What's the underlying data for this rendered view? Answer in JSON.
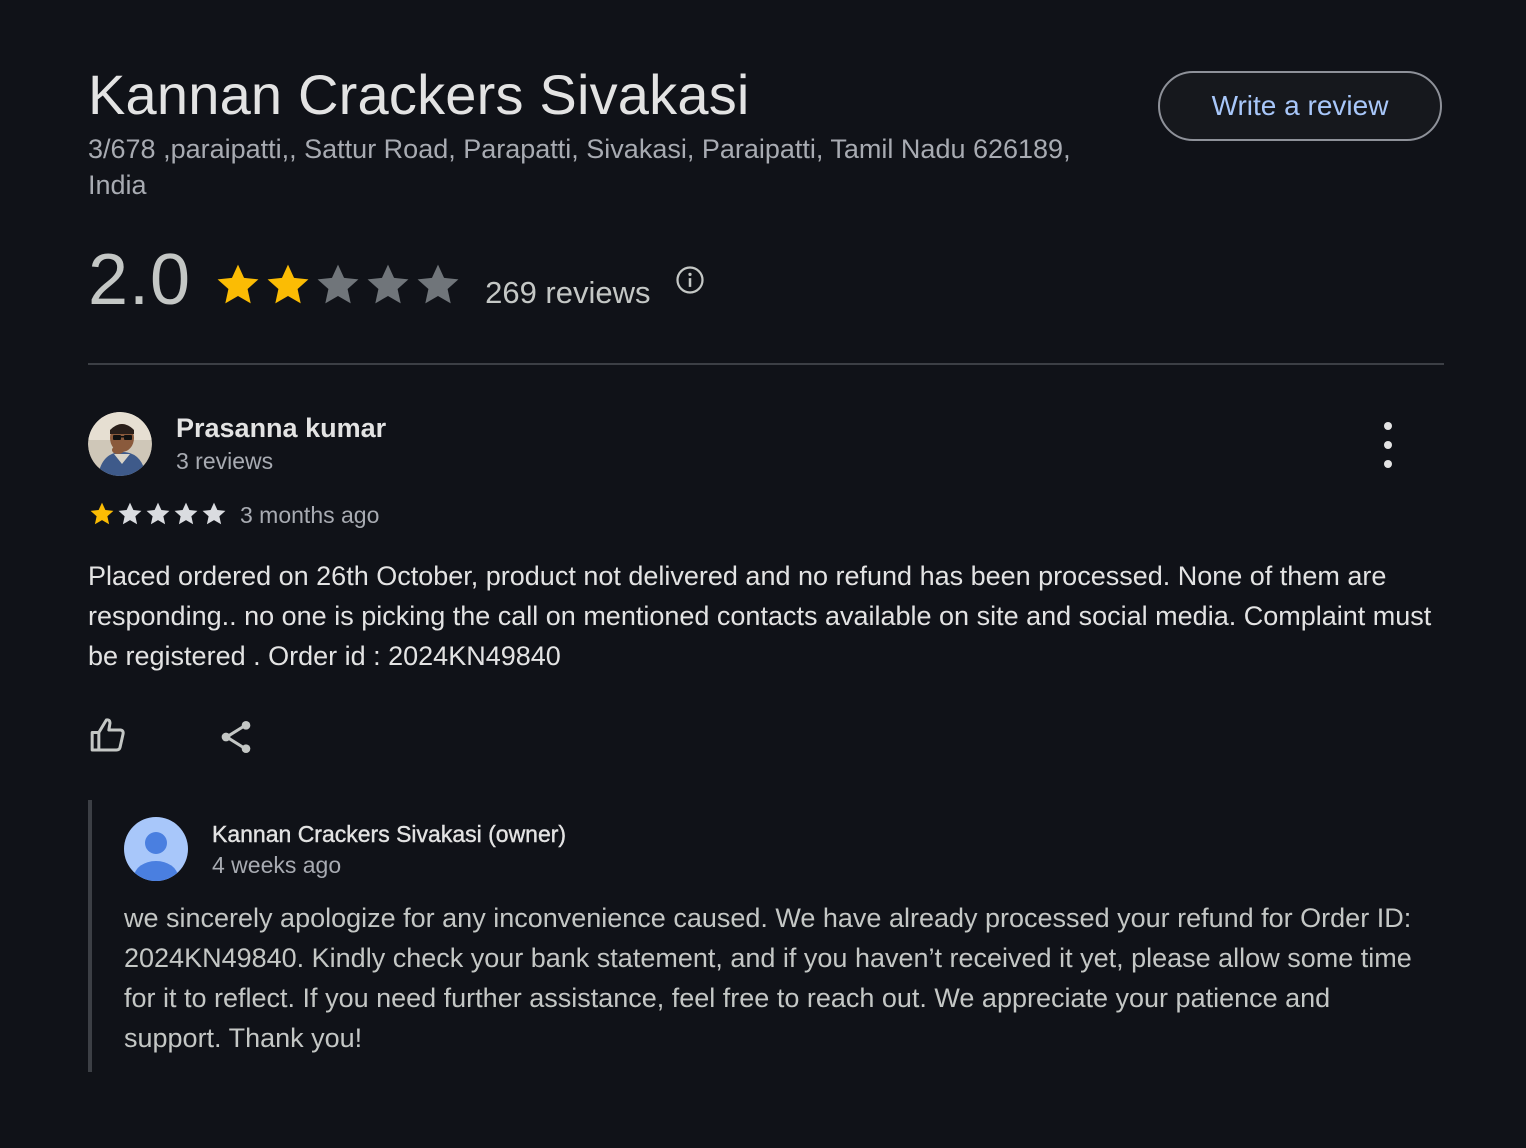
{
  "place": {
    "title": "Kannan Crackers Sivakasi",
    "address": "3/678 ,paraipatti,, Sattur Road, Parapatti, Sivakasi, Paraipatti, Tamil Nadu 626189, India",
    "write_review_label": "Write a review"
  },
  "rating": {
    "value": "2.0",
    "stars_filled": 2,
    "stars_total": 5,
    "review_count_text": "269 reviews",
    "info_icon": "info-circle-icon"
  },
  "review": {
    "author": "Prasanna kumar",
    "author_sub": "3 reviews",
    "stars_filled": 1,
    "stars_total": 5,
    "time": "3 months ago",
    "text": "Placed ordered on 26th October, product not delivered and no refund has been processed. None of them are responding.. no one is picking the call on mentioned contacts available on site and social media. Complaint must be registered . Order id : 2024KN49840",
    "more_icon": "more-vert-icon",
    "like_icon": "thumb-up-icon",
    "share_icon": "share-icon"
  },
  "owner_response": {
    "author": "Kannan Crackers Sivakasi (owner)",
    "time": "4 weeks ago",
    "text": "we sincerely apologize for any inconvenience caused. We have already processed your refund for Order ID: 2024KN49840. Kindly check your bank statement, and if you haven’t received it yet, please allow some time for it to reflect. If you need further assistance, feel free to reach out. We appreciate your patience and support. Thank you!"
  },
  "colors": {
    "background": "#101218",
    "star_filled": "#fbbc04",
    "star_empty": "#70757a",
    "link": "#a8c7fa"
  }
}
